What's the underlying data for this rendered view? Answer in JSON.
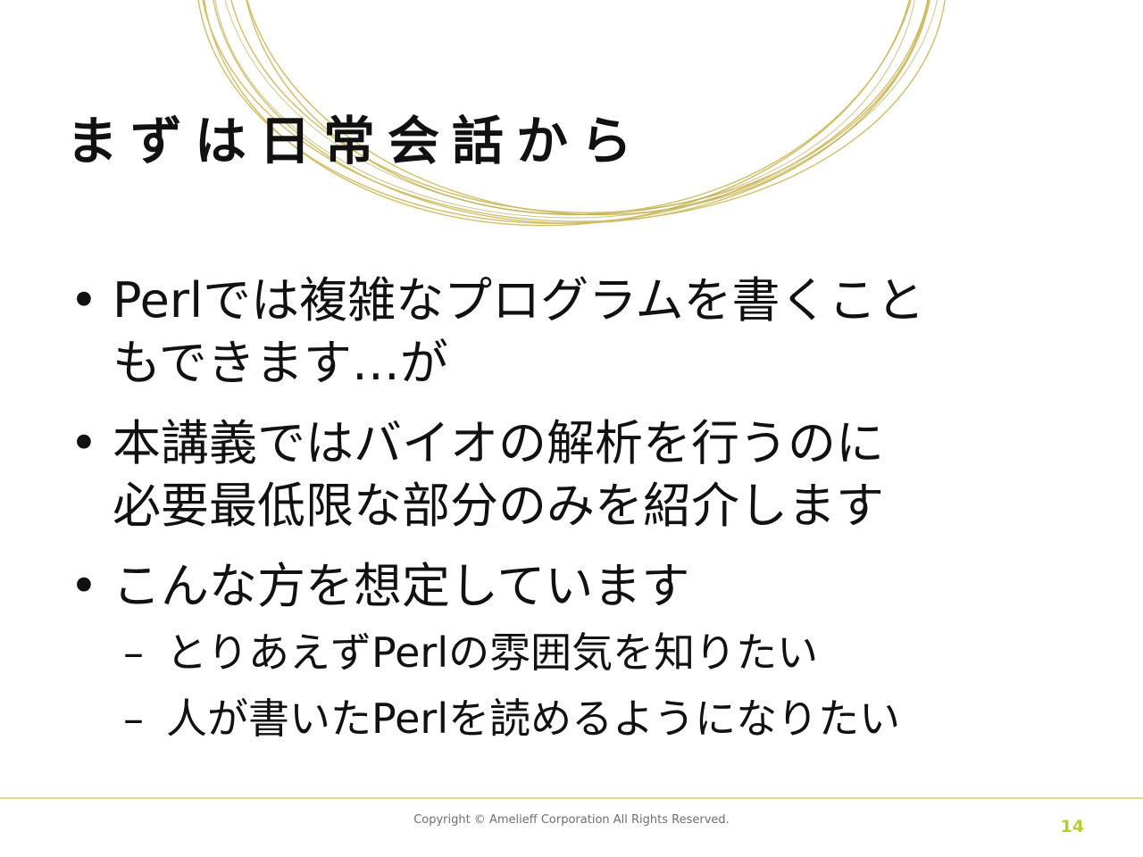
{
  "slide": {
    "title": "まずは日常会話から",
    "bullets": [
      {
        "lines": [
          "Perlでは複雑なプログラムを書くこと",
          "もできます…が"
        ]
      },
      {
        "lines": [
          "本講義ではバイオの解析を行うのに",
          "必要最低限な部分のみを紹介します"
        ]
      },
      {
        "lines": [
          "こんな方を想定しています"
        ]
      }
    ],
    "sub_bullets": [
      "とりあえずPerlの雰囲気を知りたい",
      "人が書いたPerlを読めるようになりたい"
    ],
    "bullet_symbol": "•",
    "dash_symbol": "–"
  },
  "footer": {
    "copyright": "Copyright © Amelieff Corporation All Rights Reserved.",
    "page_number": "14"
  },
  "colors": {
    "accent": "#b6cf2a",
    "ring_gold": "#c9b24a",
    "footer_rule": "#d3e08a"
  }
}
